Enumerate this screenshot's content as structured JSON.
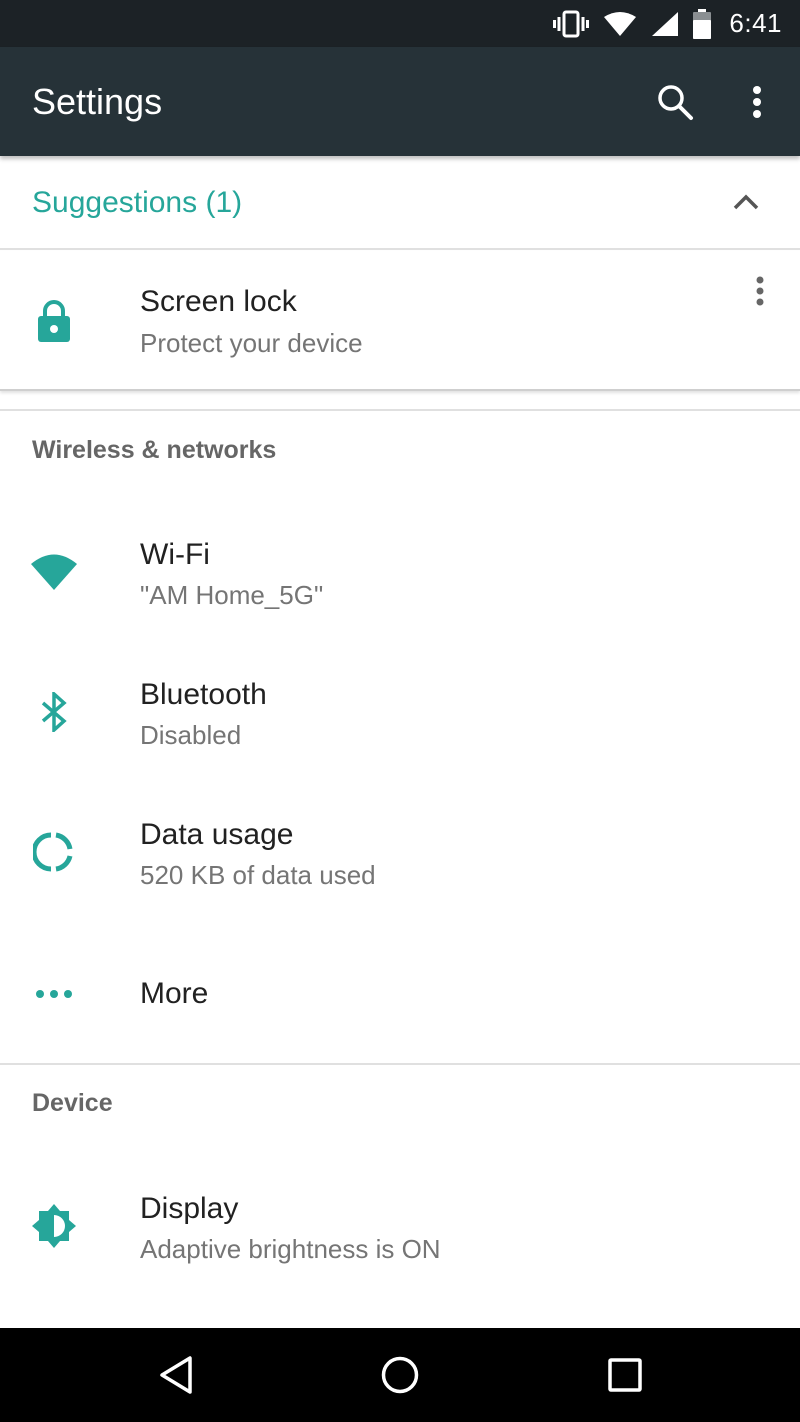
{
  "status_bar": {
    "time": "6:41",
    "icons": [
      "vibrate-icon",
      "wifi-signal-icon",
      "cell-signal-icon",
      "battery-icon"
    ]
  },
  "toolbar": {
    "title": "Settings",
    "icons": [
      "search-icon",
      "overflow-menu-icon"
    ]
  },
  "suggestions": {
    "header": "Suggestions (1)",
    "collapse_icon": "chevron-up-icon",
    "items": [
      {
        "title": "Screen lock",
        "subtitle": "Protect your device",
        "icon": "lock-icon"
      }
    ]
  },
  "sections": [
    {
      "title": "Wireless & networks",
      "items": [
        {
          "title": "Wi-Fi",
          "subtitle": "\"AM Home_5G\"",
          "icon": "wifi-icon"
        },
        {
          "title": "Bluetooth",
          "subtitle": "Disabled",
          "icon": "bluetooth-icon"
        },
        {
          "title": "Data usage",
          "subtitle": "520 KB of data used",
          "icon": "data-usage-icon"
        },
        {
          "title": "More",
          "subtitle": "",
          "icon": "more-horiz-icon"
        }
      ]
    },
    {
      "title": "Device",
      "items": [
        {
          "title": "Display",
          "subtitle": "Adaptive brightness is ON",
          "icon": "brightness-icon"
        }
      ]
    }
  ],
  "nav_bar": {
    "buttons": [
      "back-icon",
      "home-icon",
      "recents-icon"
    ]
  },
  "colors": {
    "accent": "#26a69a",
    "toolbar": "#263238",
    "status_bar": "#1c2226",
    "primary_text": "#212121",
    "secondary_text": "#757575"
  }
}
